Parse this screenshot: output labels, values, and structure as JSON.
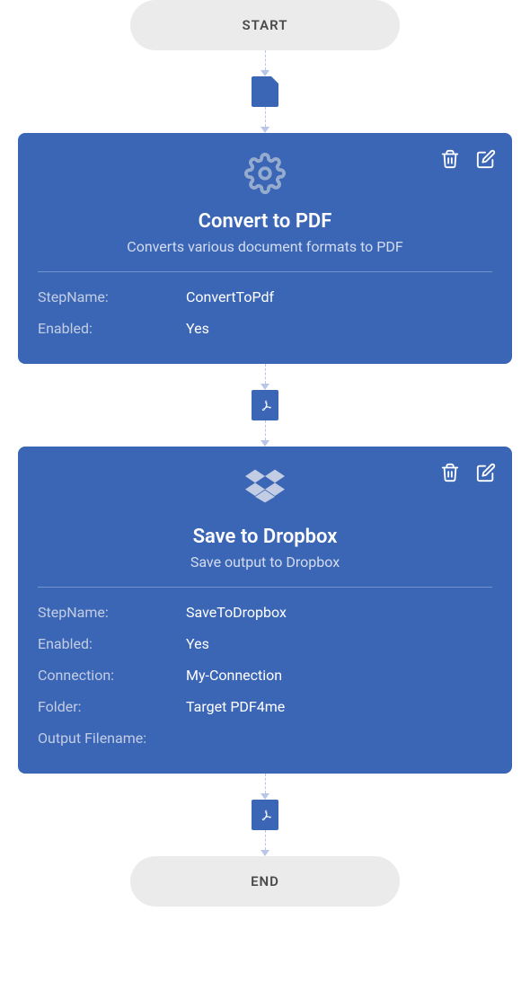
{
  "start": {
    "label": "START"
  },
  "end": {
    "label": "END"
  },
  "icons": {
    "docBadge": "document-icon",
    "pdfBadge": "pdf-icon"
  },
  "cards": [
    {
      "icon": "gear-icon",
      "title": "Convert to PDF",
      "subtitle": "Converts various document formats to PDF",
      "rows": [
        {
          "label": "StepName:",
          "value": "ConvertToPdf"
        },
        {
          "label": "Enabled:",
          "value": "Yes"
        }
      ]
    },
    {
      "icon": "dropbox-icon",
      "title": "Save to Dropbox",
      "subtitle": "Save output to Dropbox",
      "rows": [
        {
          "label": "StepName:",
          "value": "SaveToDropbox"
        },
        {
          "label": "Enabled:",
          "value": "Yes"
        },
        {
          "label": "Connection:",
          "value": "My-Connection"
        },
        {
          "label": "Folder:",
          "value": "Target PDF4me"
        },
        {
          "label": "Output Filename:",
          "value": ""
        }
      ]
    }
  ]
}
